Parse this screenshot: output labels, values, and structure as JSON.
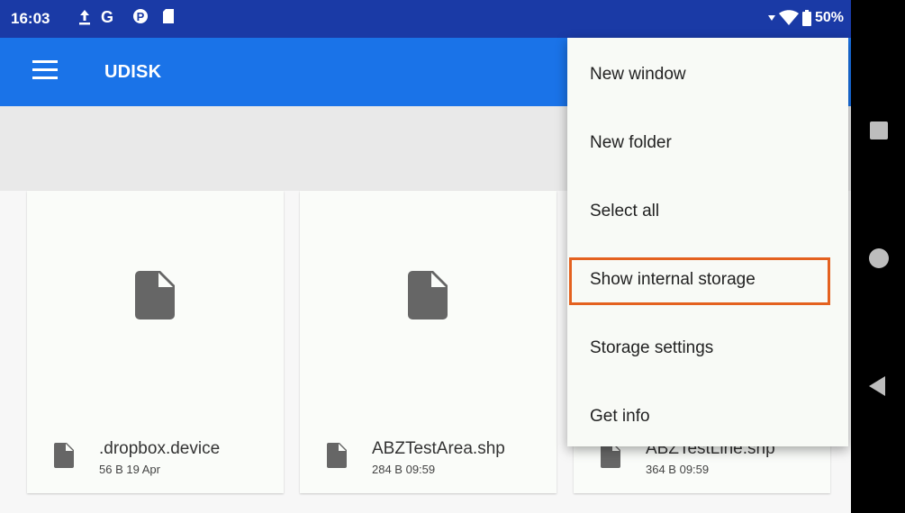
{
  "status_bar": {
    "time": "16:03",
    "icons": [
      "upload-icon",
      "google-icon",
      "parking-icon",
      "sd-card-icon"
    ],
    "battery": "50%"
  },
  "app_bar": {
    "title": "UDISK"
  },
  "files": [
    {
      "name": ".dropbox.device",
      "meta": "56 B 19 Apr"
    },
    {
      "name": "ABZTestArea.shp",
      "meta": "284 B 09:59"
    },
    {
      "name": "ABZTestLine.shp",
      "meta": "364 B 09:59"
    }
  ],
  "menu": {
    "items": [
      {
        "label": "New window"
      },
      {
        "label": "New folder"
      },
      {
        "label": "Select all"
      },
      {
        "label": "Show internal storage"
      },
      {
        "label": "Storage settings"
      },
      {
        "label": "Get info"
      }
    ],
    "highlighted_item": "Show internal storage",
    "highlight_color": "#e4611f"
  },
  "colors": {
    "status_bar": "#1a3aa6",
    "app_bar": "#1a73e8"
  }
}
